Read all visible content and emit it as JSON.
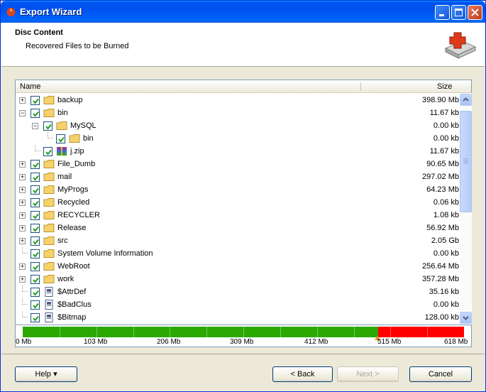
{
  "window": {
    "title": "Export Wizard"
  },
  "header": {
    "title": "Disc Content",
    "subtitle": "Recovered Files to be Burned"
  },
  "columns": {
    "name": "Name",
    "size": "Size"
  },
  "rows": [
    {
      "name": "backup",
      "size": "398.90 Mb",
      "type": "folder",
      "level": 0,
      "expander": "+"
    },
    {
      "name": "bin",
      "size": "11.67 kb",
      "type": "folder",
      "level": 0,
      "expander": "−"
    },
    {
      "name": "MySQL",
      "size": "0.00 kb",
      "type": "folder",
      "level": 1,
      "expander": "−"
    },
    {
      "name": "bin",
      "size": "0.00 kb",
      "type": "folder",
      "level": 2,
      "expander": ""
    },
    {
      "name": "j.zip",
      "size": "11.67 kb",
      "type": "zip",
      "level": 1,
      "expander": ""
    },
    {
      "name": "File_Dumb",
      "size": "90.65 Mb",
      "type": "folder",
      "level": 0,
      "expander": "+"
    },
    {
      "name": "mail",
      "size": "297.02 Mb",
      "type": "folder",
      "level": 0,
      "expander": "+"
    },
    {
      "name": "MyProgs",
      "size": "64.23 Mb",
      "type": "folder",
      "level": 0,
      "expander": "+"
    },
    {
      "name": "Recycled",
      "size": "0.06 kb",
      "type": "folder",
      "level": 0,
      "expander": "+"
    },
    {
      "name": "RECYCLER",
      "size": "1.08 kb",
      "type": "folder",
      "level": 0,
      "expander": "+"
    },
    {
      "name": "Release",
      "size": "56.92 Mb",
      "type": "folder",
      "level": 0,
      "expander": "+"
    },
    {
      "name": "src",
      "size": "2.05 Gb",
      "type": "folder",
      "level": 0,
      "expander": "+"
    },
    {
      "name": "System Volume Information",
      "size": "0.00 kb",
      "type": "folder",
      "level": 0,
      "expander": ""
    },
    {
      "name": "WebRoot",
      "size": "256.64 Mb",
      "type": "folder",
      "level": 0,
      "expander": "+"
    },
    {
      "name": "work",
      "size": "357.28 Mb",
      "type": "folder",
      "level": 0,
      "expander": "+"
    },
    {
      "name": "$AttrDef",
      "size": "35.16 kb",
      "type": "file",
      "level": 0,
      "expander": ""
    },
    {
      "name": "$BadClus",
      "size": "0.00 kb",
      "type": "file",
      "level": 0,
      "expander": ""
    },
    {
      "name": "$Bitmap",
      "size": "128.00 kb",
      "type": "file",
      "level": 0,
      "expander": ""
    }
  ],
  "gauge": {
    "labels": [
      "0 Mb",
      "103 Mb",
      "206 Mb",
      "309 Mb",
      "412 Mb",
      "515 Mb",
      "618 Mb"
    ],
    "used_fraction": 0.805,
    "marker_fraction": 0.805,
    "colors": {
      "used": "#2ca803",
      "over": "#ff0000"
    }
  },
  "buttons": {
    "help": "Help ▾",
    "back": "< Back",
    "next": "Next >",
    "cancel": "Cancel"
  },
  "colors": {
    "titlebar": "#0053ee",
    "folder": "#f5d26b",
    "check": "#21a121"
  }
}
